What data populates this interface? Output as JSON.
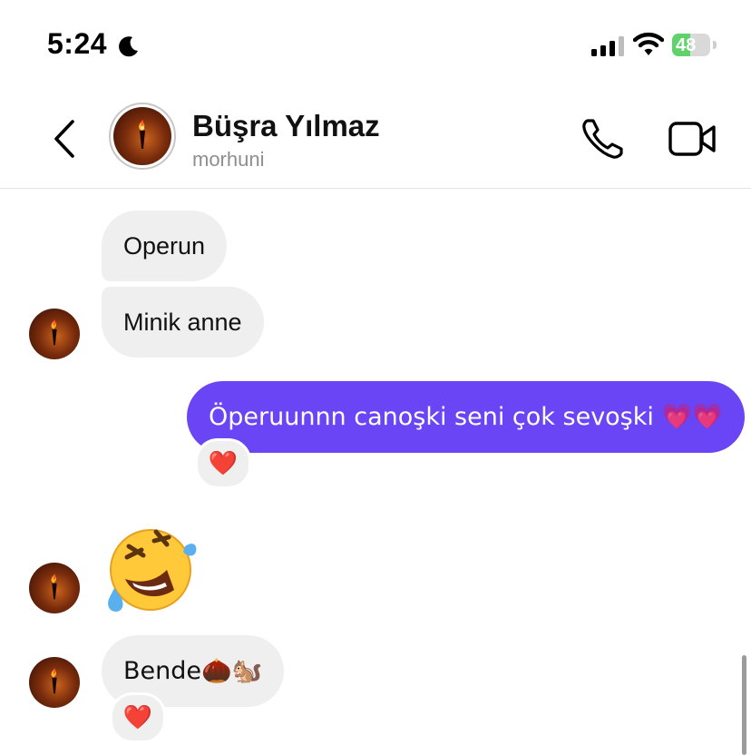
{
  "status_bar": {
    "time": "5:24",
    "battery": "48",
    "battery_level": 0.48,
    "icons": [
      "moon-icon",
      "cellular-signal-icon",
      "wifi-icon",
      "battery-icon"
    ]
  },
  "header": {
    "contact_name": "Büşra Yılmaz",
    "username": "morhuni",
    "icons": [
      "chevron-left-icon",
      "phone-icon",
      "video-camera-icon"
    ]
  },
  "messages": [
    {
      "direction": "received",
      "text": "Operun"
    },
    {
      "direction": "received",
      "text": "Minik anne"
    },
    {
      "direction": "sent",
      "text": "Öperuunnn canoşki seni çok sevoşki 💗💗",
      "reaction": "❤️"
    },
    {
      "direction": "received",
      "emoji": "🤣"
    },
    {
      "direction": "received",
      "text": "Bende🌰🐿️",
      "reaction": "❤️"
    }
  ],
  "colors": {
    "sent_bubble": "#6a45f5",
    "received_bubble": "#efefef",
    "battery_fill": "#5fd36a",
    "secondary_text": "#8e8e8e"
  }
}
